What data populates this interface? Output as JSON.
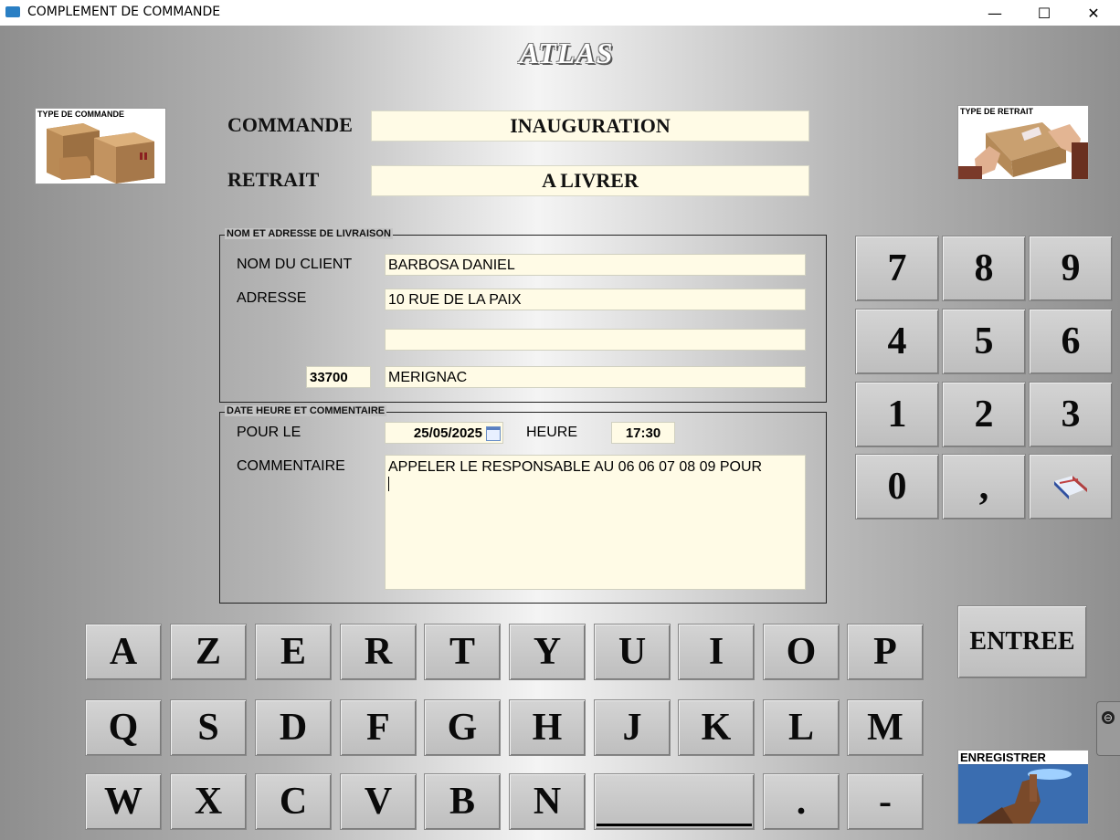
{
  "window": {
    "title": "COMPLEMENT DE COMMANDE",
    "minimize": "—",
    "maximize": "☐",
    "close": "✕"
  },
  "logo": "ATLAS",
  "order": {
    "commande_label": "COMMANDE",
    "commande_value": "INAUGURATION",
    "retrait_label": "RETRAIT",
    "retrait_value": "A LIVRER"
  },
  "type_commande_caption": "TYPE DE COMMANDE",
  "type_retrait_caption": "TYPE DE RETRAIT",
  "delivery": {
    "legend": "NOM ET ADRESSE DE LIVRAISON",
    "client_label": "NOM DU CLIENT",
    "client_value": "BARBOSA DANIEL",
    "address_label": "ADRESSE",
    "address_line1": "10 RUE DE LA PAIX",
    "address_line2": "",
    "postcode": "33700",
    "city": "MERIGNAC"
  },
  "schedule": {
    "legend": "DATE HEURE ET COMMENTAIRE",
    "date_label": "POUR LE",
    "date_value": "25/05/2025",
    "time_label": "HEURE",
    "time_value": "17:30",
    "comment_label": "COMMENTAIRE",
    "comment_value": "APPELER LE RESPONSABLE AU 06 06 07 08 09 POUR"
  },
  "numpad": [
    "7",
    "8",
    "9",
    "4",
    "5",
    "6",
    "1",
    "2",
    "3",
    "0",
    ","
  ],
  "keyboard": {
    "row1": [
      "A",
      "Z",
      "E",
      "R",
      "T",
      "Y",
      "U",
      "I",
      "O",
      "P"
    ],
    "row2": [
      "Q",
      "S",
      "D",
      "F",
      "G",
      "H",
      "J",
      "K",
      "L",
      "M"
    ],
    "row3": [
      "W",
      "X",
      "C",
      "V",
      "B",
      "N"
    ],
    "dot": ".",
    "dash": "-"
  },
  "entree_label": "ENTREE",
  "enregistrer_caption": "ENREGISTRER"
}
